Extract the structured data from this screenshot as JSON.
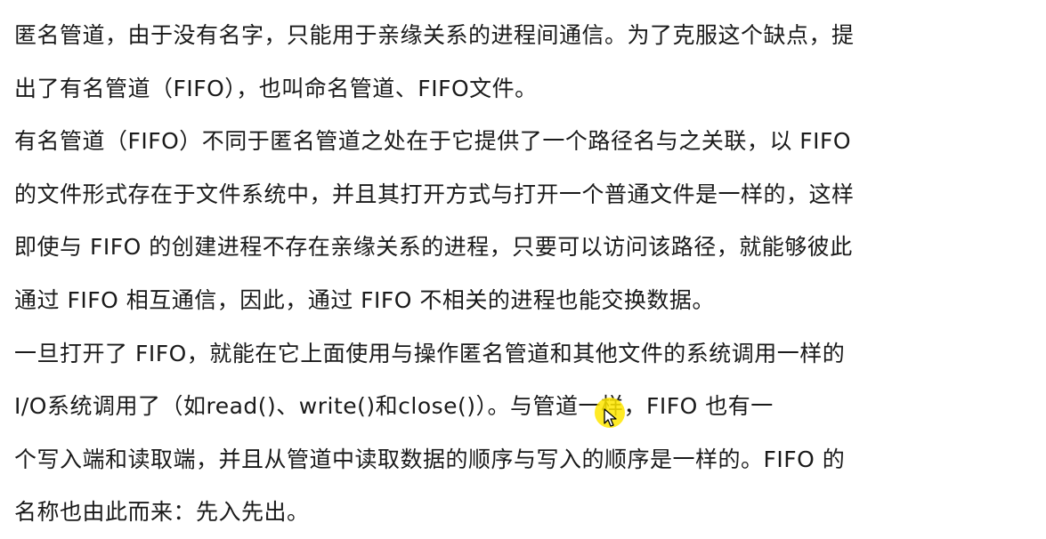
{
  "document": {
    "lines": [
      "匿名管道，由于没有名字，只能用于亲缘关系的进程间通信。为了克服这个缺点，提",
      "出了有名管道（FIFO），也叫命名管道、FIFO文件。",
      "有名管道（FIFO）不同于匿名管道之处在于它提供了一个路径名与之关联，以 FIFO",
      "的文件形式存在于文件系统中，并且其打开方式与打开一个普通文件是一样的，这样",
      "即使与 FIFO 的创建进程不存在亲缘关系的进程，只要可以访问该路径，就能够彼此",
      "通过 FIFO 相互通信，因此，通过 FIFO 不相关的进程也能交换数据。",
      "一旦打开了 FIFO，就能在它上面使用与操作匿名管道和其他文件的系统调用一样的",
      "I/O系统调用了（如read()、write()和close()）。与管道一样，FIFO 也有一",
      "个写入端和读取端，并且从管道中读取数据的顺序与写入的顺序是一样的。FIFO 的",
      "名称也由此而来：先入先出。"
    ]
  },
  "cursor": {
    "highlight_color": "#FFE600",
    "icon": "mouse-pointer-icon"
  }
}
